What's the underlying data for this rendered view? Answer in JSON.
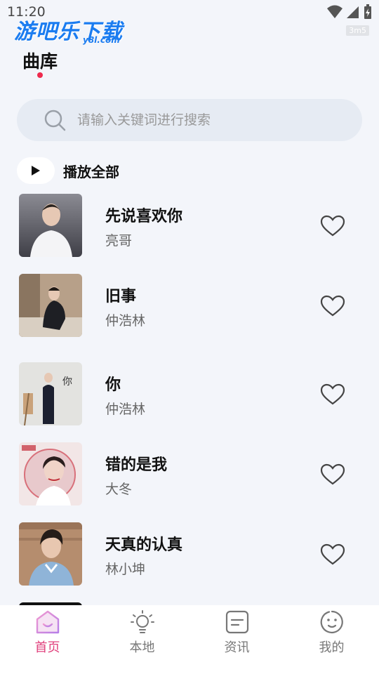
{
  "status_bar": {
    "time": "11:20",
    "badge": "3m5"
  },
  "watermark": {
    "text": "游吧乐下载",
    "sub": "y8l.com"
  },
  "header": {
    "title": "曲库"
  },
  "search": {
    "placeholder": "请输入关键词进行搜索"
  },
  "play_all": {
    "label": "播放全部"
  },
  "songs": [
    {
      "title": "先说喜欢你",
      "artist": "亮哥"
    },
    {
      "title": "旧事",
      "artist": "仲浩林"
    },
    {
      "title": "你",
      "artist": "仲浩林"
    },
    {
      "title": "错的是我",
      "artist": "大冬"
    },
    {
      "title": "天真的认真",
      "artist": "林小坤"
    }
  ],
  "tabs": [
    {
      "label": "首页",
      "icon": "home-icon",
      "active": true
    },
    {
      "label": "本地",
      "icon": "lightbulb-icon",
      "active": false
    },
    {
      "label": "资讯",
      "icon": "news-icon",
      "active": false
    },
    {
      "label": "我的",
      "icon": "smiley-icon",
      "active": false
    }
  ],
  "colors": {
    "accent": "#e0407c",
    "title_dot": "#ee2a4d",
    "background": "#f3f5fa",
    "search_bg": "#e6ebf3"
  }
}
